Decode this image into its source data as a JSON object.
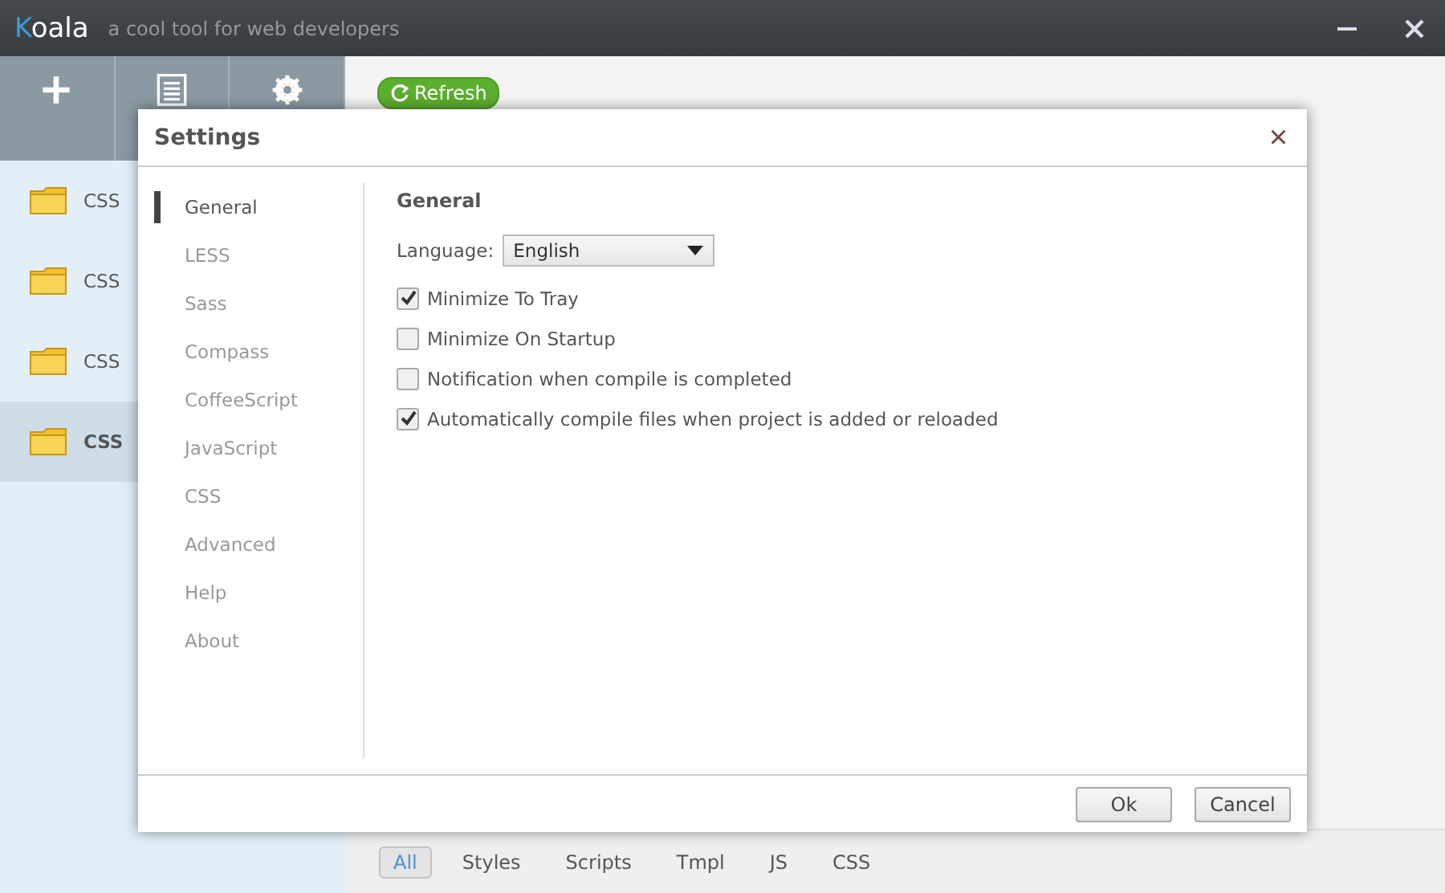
{
  "app": {
    "logo_first": "K",
    "logo_rest": "oala",
    "tagline": "a cool tool for web developers"
  },
  "toolbar": [
    {
      "kind": "add"
    },
    {
      "kind": "list"
    },
    {
      "kind": "settings"
    }
  ],
  "projects": [
    {
      "name": "CSS",
      "selected": false
    },
    {
      "name": "CSS",
      "selected": false
    },
    {
      "name": "CSS",
      "selected": false
    },
    {
      "name": "CSS",
      "selected": true
    }
  ],
  "refresh": "Refresh",
  "filters": [
    {
      "label": "All",
      "selected": true
    },
    {
      "label": "Styles",
      "selected": false
    },
    {
      "label": "Scripts",
      "selected": false
    },
    {
      "label": "Tmpl",
      "selected": false
    },
    {
      "label": "JS",
      "selected": false
    },
    {
      "label": "CSS",
      "selected": false
    }
  ],
  "dialog": {
    "title": "Settings",
    "close": "×",
    "nav": [
      {
        "label": "General",
        "selected": true
      },
      {
        "label": "LESS",
        "selected": false
      },
      {
        "label": "Sass",
        "selected": false
      },
      {
        "label": "Compass",
        "selected": false
      },
      {
        "label": "CoffeeScript",
        "selected": false
      },
      {
        "label": "JavaScript",
        "selected": false
      },
      {
        "label": "CSS",
        "selected": false
      },
      {
        "label": "Advanced",
        "selected": false
      },
      {
        "label": "Help",
        "selected": false
      },
      {
        "label": "About",
        "selected": false
      }
    ],
    "heading": "General",
    "language": {
      "label": "Language:",
      "value": "English"
    },
    "options": [
      {
        "label": "Minimize To Tray",
        "checked": true
      },
      {
        "label": "Minimize On Startup",
        "checked": false
      },
      {
        "label": "Notification when compile is completed",
        "checked": false
      },
      {
        "label": "Automatically compile files when project is added or reloaded",
        "checked": true
      }
    ],
    "buttons": [
      "Ok",
      "Cancel"
    ]
  }
}
